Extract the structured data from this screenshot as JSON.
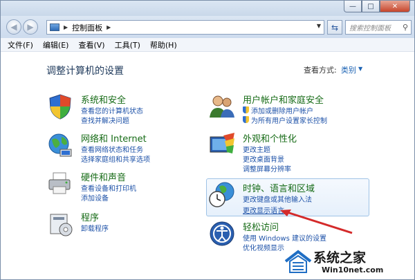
{
  "window": {
    "controls": {
      "minimize": "—",
      "maximize": "□",
      "close": "✕"
    }
  },
  "nav": {
    "back_icon": "back-arrow-icon",
    "forward_icon": "forward-arrow-icon",
    "breadcrumb": "控制面板",
    "search_placeholder": "搜索控制面板"
  },
  "menu": [
    "文件(F)",
    "编辑(E)",
    "查看(V)",
    "工具(T)",
    "帮助(H)"
  ],
  "header": {
    "title": "调整计算机的设置",
    "view_by_label": "查看方式:",
    "view_by_value": "类别"
  },
  "categories": [
    {
      "title": "系统和安全",
      "icon": "shield-icon",
      "links": [
        "查看您的计算机状态",
        "查找并解决问题"
      ]
    },
    {
      "title": "网络和 Internet",
      "icon": "globe-network-icon",
      "links": [
        "查看网络状态和任务",
        "选择家庭组和共享选项"
      ]
    },
    {
      "title": "硬件和声音",
      "icon": "printer-icon",
      "links": [
        "查看设备和打印机",
        "添加设备"
      ]
    },
    {
      "title": "程序",
      "icon": "programs-icon",
      "links": [
        "卸载程序"
      ]
    },
    {
      "title": "用户帐户和家庭安全",
      "icon": "users-icon",
      "links": [
        "添加或删除用户帐户",
        "为所有用户设置家长控制"
      ]
    },
    {
      "title": "外观和个性化",
      "icon": "appearance-icon",
      "links": [
        "更改主题",
        "更改桌面背景",
        "调整屏幕分辨率"
      ]
    },
    {
      "title": "时钟、语言和区域",
      "icon": "clock-globe-icon",
      "links": [
        "更改键盘或其他输入法",
        "更改显示语言"
      ]
    },
    {
      "title": "轻松访问",
      "icon": "ease-of-access-icon",
      "links": [
        "使用 Windows 建议的设置",
        "优化视频显示"
      ]
    }
  ],
  "watermark": {
    "title": "系统之家",
    "subtitle": "Win10net.com"
  },
  "colors": {
    "category_title": "#166b16",
    "link": "#1e52a8",
    "arrow": "#d42a2a"
  }
}
